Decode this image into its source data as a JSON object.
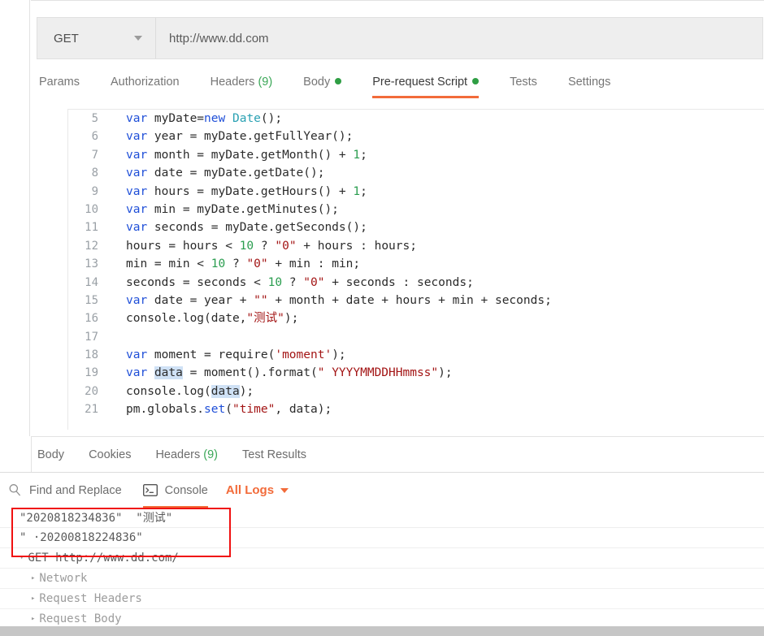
{
  "corner": {
    "glyph": "∘∘"
  },
  "request": {
    "method": "GET",
    "method_caret": "chevron-down-icon",
    "url": "http://www.dd.com",
    "tabs": [
      {
        "label": "Params",
        "count": "",
        "dot": false,
        "active": false
      },
      {
        "label": "Authorization",
        "count": "",
        "dot": false,
        "active": false
      },
      {
        "label": "Headers",
        "count": "(9)",
        "dot": false,
        "active": false
      },
      {
        "label": "Body",
        "count": "",
        "dot": true,
        "active": false
      },
      {
        "label": "Pre-request Script",
        "count": "",
        "dot": true,
        "active": true
      },
      {
        "label": "Tests",
        "count": "",
        "dot": false,
        "active": false
      },
      {
        "label": "Settings",
        "count": "",
        "dot": false,
        "active": false
      }
    ]
  },
  "editor": {
    "lines": [
      {
        "n": "5",
        "tokens": [
          {
            "t": "var",
            "c": "k"
          },
          {
            "t": " myDate=",
            "c": ""
          },
          {
            "t": "new",
            "c": "k"
          },
          {
            "t": " ",
            "c": ""
          },
          {
            "t": "Date",
            "c": "typ"
          },
          {
            "t": "();",
            "c": ""
          }
        ]
      },
      {
        "n": "6",
        "tokens": [
          {
            "t": "var",
            "c": "k"
          },
          {
            "t": " year = myDate.getFullYear();",
            "c": ""
          }
        ]
      },
      {
        "n": "7",
        "tokens": [
          {
            "t": "var",
            "c": "k"
          },
          {
            "t": " month = myDate.getMonth() + ",
            "c": ""
          },
          {
            "t": "1",
            "c": "num"
          },
          {
            "t": ";",
            "c": ""
          }
        ]
      },
      {
        "n": "8",
        "tokens": [
          {
            "t": "var",
            "c": "k"
          },
          {
            "t": " date = myDate.getDate();",
            "c": ""
          }
        ]
      },
      {
        "n": "9",
        "tokens": [
          {
            "t": "var",
            "c": "k"
          },
          {
            "t": " hours = myDate.getHours() + ",
            "c": ""
          },
          {
            "t": "1",
            "c": "num"
          },
          {
            "t": ";",
            "c": ""
          }
        ]
      },
      {
        "n": "10",
        "tokens": [
          {
            "t": "var",
            "c": "k"
          },
          {
            "t": " min = myDate.getMinutes();",
            "c": ""
          }
        ]
      },
      {
        "n": "11",
        "tokens": [
          {
            "t": "var",
            "c": "k"
          },
          {
            "t": " seconds = myDate.getSeconds();",
            "c": ""
          }
        ]
      },
      {
        "n": "12",
        "tokens": [
          {
            "t": "hours = hours < ",
            "c": ""
          },
          {
            "t": "10",
            "c": "num"
          },
          {
            "t": " ? ",
            "c": ""
          },
          {
            "t": "\"0\"",
            "c": "str"
          },
          {
            "t": " + hours : hours;",
            "c": ""
          }
        ]
      },
      {
        "n": "13",
        "tokens": [
          {
            "t": "min = min < ",
            "c": ""
          },
          {
            "t": "10",
            "c": "num"
          },
          {
            "t": " ? ",
            "c": ""
          },
          {
            "t": "\"0\"",
            "c": "str"
          },
          {
            "t": " + min : min;",
            "c": ""
          }
        ]
      },
      {
        "n": "14",
        "tokens": [
          {
            "t": "seconds = seconds < ",
            "c": ""
          },
          {
            "t": "10",
            "c": "num"
          },
          {
            "t": " ? ",
            "c": ""
          },
          {
            "t": "\"0\"",
            "c": "str"
          },
          {
            "t": " + seconds : seconds;",
            "c": ""
          }
        ]
      },
      {
        "n": "15",
        "tokens": [
          {
            "t": "var",
            "c": "k"
          },
          {
            "t": " date = year + ",
            "c": ""
          },
          {
            "t": "\"\"",
            "c": "str"
          },
          {
            "t": " + month + date + hours + min + seconds;",
            "c": ""
          }
        ]
      },
      {
        "n": "16",
        "tokens": [
          {
            "t": "console.log(date,",
            "c": ""
          },
          {
            "t": "\"测试\"",
            "c": "str"
          },
          {
            "t": ");",
            "c": ""
          }
        ]
      },
      {
        "n": "17",
        "tokens": []
      },
      {
        "n": "18",
        "tokens": [
          {
            "t": "var",
            "c": "k"
          },
          {
            "t": " moment = require(",
            "c": ""
          },
          {
            "t": "'moment'",
            "c": "str"
          },
          {
            "t": ");",
            "c": ""
          }
        ]
      },
      {
        "n": "19",
        "tokens": [
          {
            "t": "var",
            "c": "k"
          },
          {
            "t": " ",
            "c": ""
          },
          {
            "t": "data",
            "c": "sel"
          },
          {
            "t": " = moment().format(",
            "c": ""
          },
          {
            "t": "\" YYYYMMDDHHmmss\"",
            "c": "str"
          },
          {
            "t": ");",
            "c": ""
          }
        ]
      },
      {
        "n": "20",
        "tokens": [
          {
            "t": "console.log(",
            "c": ""
          },
          {
            "t": "data",
            "c": "sel"
          },
          {
            "t": ");",
            "c": ""
          }
        ]
      },
      {
        "n": "21",
        "tokens": [
          {
            "t": "pm.globals.",
            "c": ""
          },
          {
            "t": "set",
            "c": "fn"
          },
          {
            "t": "(",
            "c": ""
          },
          {
            "t": "\"time\"",
            "c": "str"
          },
          {
            "t": ", data);",
            "c": ""
          }
        ]
      }
    ]
  },
  "response": {
    "tabs": [
      {
        "label": "Body",
        "count": ""
      },
      {
        "label": "Cookies",
        "count": ""
      },
      {
        "label": "Headers",
        "count": "(9)"
      },
      {
        "label": "Test Results",
        "count": ""
      }
    ]
  },
  "console_bar": {
    "find_replace": "Find and Replace",
    "find_icon": "search-icon",
    "console_label": "Console",
    "console_icon": "terminal-icon",
    "all_logs": "All Logs",
    "all_logs_caret": "chevron-down-icon"
  },
  "console_log": {
    "entries": [
      {
        "type": "output",
        "text": "\"2020818234836\"  \"测试\"",
        "indent": 0,
        "twisty": ""
      },
      {
        "type": "output",
        "text": "\" ·20200818224836\"",
        "indent": 0,
        "twisty": ""
      },
      {
        "type": "request",
        "text": "GET http://www.dd.com/",
        "indent": 0,
        "twisty": "▾"
      },
      {
        "type": "section",
        "text": "Network",
        "indent": 1,
        "twisty": "▸"
      },
      {
        "type": "section",
        "text": "Request Headers",
        "indent": 1,
        "twisty": "▸"
      },
      {
        "type": "section",
        "text": "Request Body",
        "indent": 1,
        "twisty": "▸"
      }
    ]
  },
  "colors": {
    "accent_orange": "#f26b3a",
    "green_dot": "#2f9e44",
    "annotation_red": "#f01010",
    "keyword_blue": "#1f4fd8",
    "string_red": "#a31515",
    "number_green": "#2a9d4f"
  }
}
